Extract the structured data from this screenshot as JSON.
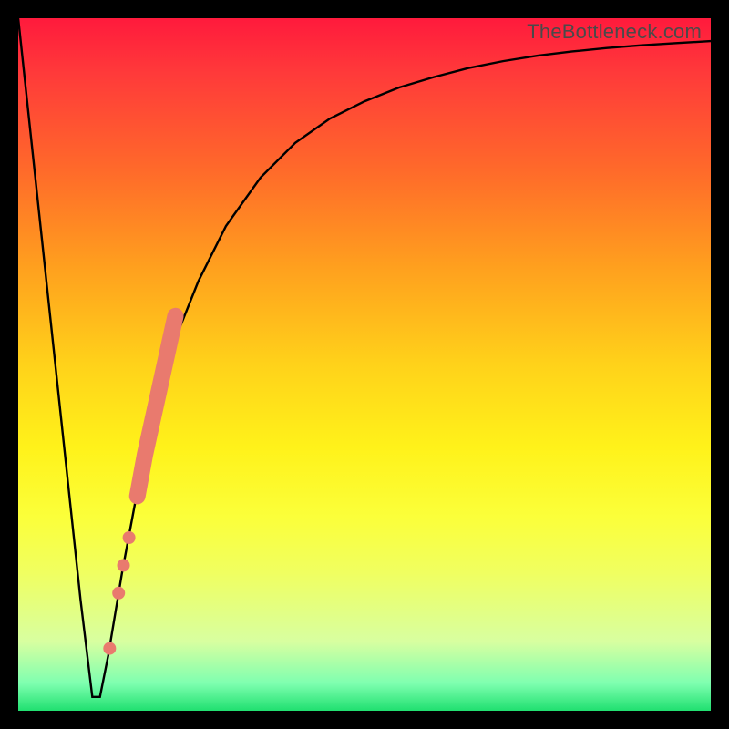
{
  "watermark": "TheBottleneck.com",
  "chart_data": {
    "type": "line",
    "title": "",
    "xlabel": "",
    "ylabel": "",
    "xlim": [
      0,
      100
    ],
    "ylim": [
      0,
      100
    ],
    "grid": false,
    "legend": false,
    "series": [
      {
        "name": "bottleneck-curve",
        "color": "#000000",
        "x": [
          0,
          3,
          6,
          9,
          10.7,
          11.8,
          13,
          15,
          18,
          22,
          26,
          30,
          35,
          40,
          45,
          50,
          55,
          60,
          65,
          70,
          75,
          80,
          85,
          90,
          95,
          100
        ],
        "y": [
          100,
          72,
          44,
          16,
          2,
          2,
          8,
          20,
          36,
          52,
          62,
          70,
          77,
          82,
          85.5,
          88,
          90,
          91.5,
          92.8,
          93.8,
          94.6,
          95.2,
          95.7,
          96.1,
          96.4,
          96.7
        ]
      }
    ],
    "highlight_band": {
      "name": "highlight-segment",
      "color": "#e97a6e",
      "points": [
        {
          "x": 13.2,
          "y": 9,
          "r": 7
        },
        {
          "x": 14.5,
          "y": 17,
          "r": 7
        },
        {
          "x": 15.2,
          "y": 21,
          "r": 7
        },
        {
          "x": 16.0,
          "y": 25,
          "r": 7
        },
        {
          "x": 17.2,
          "y": 31,
          "r": 9
        },
        {
          "x": 18.3,
          "y": 37,
          "r": 9
        },
        {
          "x": 19.4,
          "y": 42,
          "r": 9
        },
        {
          "x": 20.5,
          "y": 47,
          "r": 9
        },
        {
          "x": 21.6,
          "y": 52,
          "r": 9
        },
        {
          "x": 22.7,
          "y": 57,
          "r": 9
        }
      ]
    }
  }
}
